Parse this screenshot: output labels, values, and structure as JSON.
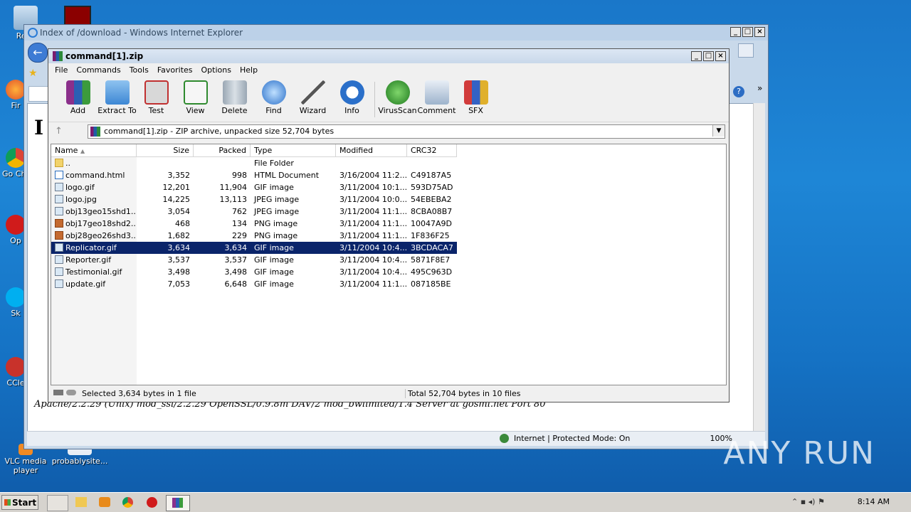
{
  "desktop": {
    "icons": [
      {
        "label": "Recy"
      },
      {
        "label": "Fir"
      },
      {
        "label": "Go Chr"
      },
      {
        "label": "Op"
      },
      {
        "label": "Sk"
      },
      {
        "label": "CCle"
      },
      {
        "label": "VLC media player"
      },
      {
        "label": "probablysite..."
      }
    ]
  },
  "ie": {
    "title": "Index of /download - Windows Internet Explorer",
    "page_heading_fragment": "I",
    "footer_text": "Apache/2.2.29 (Unix) mod_ssl/2.2.29 OpenSSL/0.9.8m DAV/2 mod_bwlimited/1.4 Server at gosmi.net Port 80",
    "status_zone": "Internet | Protected Mode: On",
    "zoom": "100%"
  },
  "rar": {
    "title": "command[1].zip",
    "menu": [
      "File",
      "Commands",
      "Tools",
      "Favorites",
      "Options",
      "Help"
    ],
    "toolbar": [
      "Add",
      "Extract To",
      "Test",
      "View",
      "Delete",
      "Find",
      "Wizard",
      "Info",
      "VirusScan",
      "Comment",
      "SFX"
    ],
    "address": "command[1].zip - ZIP archive, unpacked size 52,704 bytes",
    "columns": [
      "Name",
      "Size",
      "Packed",
      "Type",
      "Modified",
      "CRC32"
    ],
    "rows": [
      {
        "name": "..",
        "size": "",
        "packed": "",
        "type": "File Folder",
        "modified": "",
        "crc": "",
        "icon": "folder"
      },
      {
        "name": "command.html",
        "size": "3,352",
        "packed": "998",
        "type": "HTML Document",
        "modified": "3/16/2004 11:2...",
        "crc": "C49187A5",
        "icon": "html"
      },
      {
        "name": "logo.gif",
        "size": "12,201",
        "packed": "11,904",
        "type": "GIF image",
        "modified": "3/11/2004 10:1...",
        "crc": "593D75AD",
        "icon": "img"
      },
      {
        "name": "logo.jpg",
        "size": "14,225",
        "packed": "13,113",
        "type": "JPEG image",
        "modified": "3/11/2004 10:0...",
        "crc": "54EBEBA2",
        "icon": "img"
      },
      {
        "name": "obj13geo15shd1...",
        "size": "3,054",
        "packed": "762",
        "type": "JPEG image",
        "modified": "3/11/2004 11:1...",
        "crc": "8CBA08B7",
        "icon": "img"
      },
      {
        "name": "obj17geo18shd2...",
        "size": "468",
        "packed": "134",
        "type": "PNG image",
        "modified": "3/11/2004 11:1...",
        "crc": "10047A9D",
        "icon": "png"
      },
      {
        "name": "obj28geo26shd3...",
        "size": "1,682",
        "packed": "229",
        "type": "PNG image",
        "modified": "3/11/2004 11:1...",
        "crc": "1F836F25",
        "icon": "png"
      },
      {
        "name": "Replicator.gif",
        "size": "3,634",
        "packed": "3,634",
        "type": "GIF image",
        "modified": "3/11/2004 10:4...",
        "crc": "3BCDACA7",
        "icon": "img"
      },
      {
        "name": "Reporter.gif",
        "size": "3,537",
        "packed": "3,537",
        "type": "GIF image",
        "modified": "3/11/2004 10:4...",
        "crc": "5871F8E7",
        "icon": "img"
      },
      {
        "name": "Testimonial.gif",
        "size": "3,498",
        "packed": "3,498",
        "type": "GIF image",
        "modified": "3/11/2004 10:4...",
        "crc": "495C963D",
        "icon": "img"
      },
      {
        "name": "update.gif",
        "size": "7,053",
        "packed": "6,648",
        "type": "GIF image",
        "modified": "3/11/2004 11:1...",
        "crc": "087185BE",
        "icon": "img"
      }
    ],
    "selected_index": 7,
    "status_left": "Selected 3,634 bytes in 1 file",
    "status_right": "Total 52,704 bytes in 10 files"
  },
  "taskbar": {
    "start_label": "Start",
    "clock": "8:14 AM"
  },
  "watermark": "ANY RUN"
}
